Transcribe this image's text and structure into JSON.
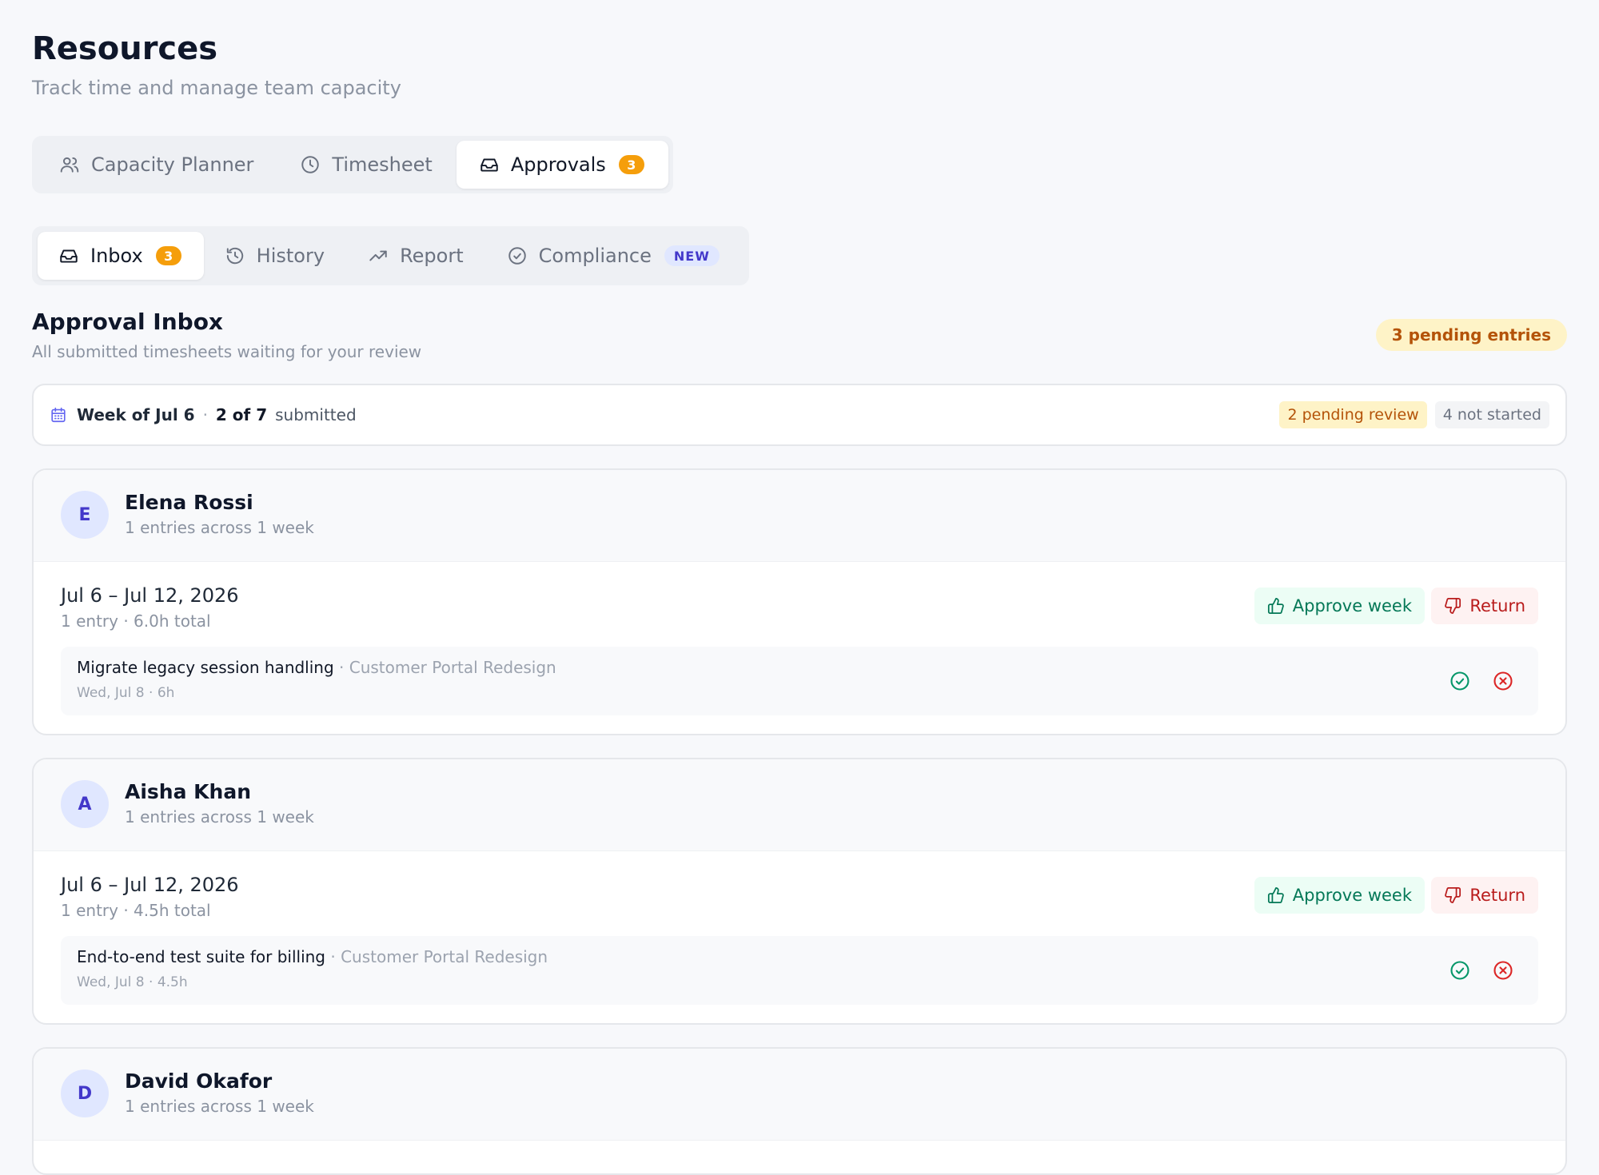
{
  "header": {
    "title": "Resources",
    "subtitle": "Track time and manage team capacity"
  },
  "main_tabs": [
    {
      "label": "Capacity Planner",
      "icon": "users-icon"
    },
    {
      "label": "Timesheet",
      "icon": "clock-icon"
    },
    {
      "label": "Approvals",
      "icon": "inbox-icon",
      "badge": "3",
      "active": true
    }
  ],
  "sub_tabs": [
    {
      "label": "Inbox",
      "icon": "inbox-icon",
      "badge": "3",
      "active": true
    },
    {
      "label": "History",
      "icon": "history-icon"
    },
    {
      "label": "Report",
      "icon": "trending-up-icon"
    },
    {
      "label": "Compliance",
      "icon": "check-circle-icon",
      "tag": "NEW"
    }
  ],
  "inbox": {
    "title": "Approval Inbox",
    "subtitle": "All submitted timesheets waiting for your review",
    "pending_label": "3 pending entries"
  },
  "week_summary": {
    "week_label": "Week of Jul 6",
    "separator": "·",
    "submitted_count": "2 of 7",
    "submitted_word": "submitted",
    "pending_chip": "2 pending review",
    "not_started_chip": "4 not started"
  },
  "people": [
    {
      "initial": "E",
      "name": "Elena Rossi",
      "meta": "1 entries across 1 week",
      "range": "Jul 6 – Jul 12, 2026",
      "range_meta": "1 entry · 6.0h total",
      "approve_label": "Approve week",
      "return_label": "Return",
      "entry_task": "Migrate legacy session handling",
      "entry_project": " · Customer Portal Redesign",
      "entry_meta": "Wed, Jul 8 · 6h"
    },
    {
      "initial": "A",
      "name": "Aisha Khan",
      "meta": "1 entries across 1 week",
      "range": "Jul 6 – Jul 12, 2026",
      "range_meta": "1 entry · 4.5h total",
      "approve_label": "Approve week",
      "return_label": "Return",
      "entry_task": "End-to-end test suite for billing",
      "entry_project": " · Customer Portal Redesign",
      "entry_meta": "Wed, Jul 8 · 4.5h"
    },
    {
      "initial": "D",
      "name": "David Okafor",
      "meta": "1 entries across 1 week"
    }
  ],
  "colors": {
    "accent_badge": "#f59e0b",
    "approve": "#047857",
    "return": "#b91c1c",
    "avatar": "#4338ca"
  }
}
